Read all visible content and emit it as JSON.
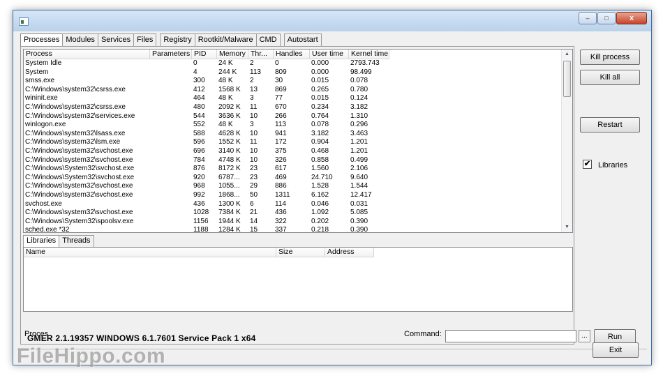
{
  "window": {
    "caption_minimize": "‒",
    "caption_maximize": "□",
    "caption_close": "x"
  },
  "tabs": [
    "Processes",
    "Modules",
    "Services",
    "Files",
    "Registry",
    "Rootkit/Malware",
    "CMD",
    "Autostart"
  ],
  "process_table": {
    "columns": [
      "Process",
      "Parameters",
      "PID",
      "Memory",
      "Thr...",
      "Handles",
      "User time",
      "Kernel time"
    ],
    "rows": [
      [
        "System Idle",
        "",
        "0",
        "24 K",
        "2",
        "0",
        "0.000",
        "2793.743"
      ],
      [
        "System",
        "",
        "4",
        "244 K",
        "113",
        "809",
        "0.000",
        "98.499"
      ],
      [
        "smss.exe",
        "",
        "300",
        "48 K",
        "2",
        "30",
        "0.015",
        "0.078"
      ],
      [
        "C:\\Windows\\system32\\csrss.exe",
        "",
        "412",
        "1568 K",
        "13",
        "869",
        "0.265",
        "0.780"
      ],
      [
        "wininit.exe",
        "",
        "464",
        "48 K",
        "3",
        "77",
        "0.015",
        "0.124"
      ],
      [
        "C:\\Windows\\system32\\csrss.exe",
        "",
        "480",
        "2092 K",
        "11",
        "670",
        "0.234",
        "3.182"
      ],
      [
        "C:\\Windows\\system32\\services.exe",
        "",
        "544",
        "3636 K",
        "10",
        "266",
        "0.764",
        "1.310"
      ],
      [
        "winlogon.exe",
        "",
        "552",
        "48 K",
        "3",
        "113",
        "0.078",
        "0.296"
      ],
      [
        "C:\\Windows\\system32\\lsass.exe",
        "",
        "588",
        "4628 K",
        "10",
        "941",
        "3.182",
        "3.463"
      ],
      [
        "C:\\Windows\\system32\\lsm.exe",
        "",
        "596",
        "1552 K",
        "11",
        "172",
        "0.904",
        "1.201"
      ],
      [
        "C:\\Windows\\system32\\svchost.exe",
        "",
        "696",
        "3140 K",
        "10",
        "375",
        "0.468",
        "1.201"
      ],
      [
        "C:\\Windows\\system32\\svchost.exe",
        "",
        "784",
        "4748 K",
        "10",
        "326",
        "0.858",
        "0.499"
      ],
      [
        "C:\\Windows\\System32\\svchost.exe",
        "",
        "876",
        "8172 K",
        "23",
        "617",
        "1.560",
        "2.106"
      ],
      [
        "C:\\Windows\\System32\\svchost.exe",
        "",
        "920",
        "6787...",
        "23",
        "469",
        "24.710",
        "9.640"
      ],
      [
        "C:\\Windows\\system32\\svchost.exe",
        "",
        "968",
        "1055...",
        "29",
        "886",
        "1.528",
        "1.544"
      ],
      [
        "C:\\Windows\\system32\\svchost.exe",
        "",
        "992",
        "1868...",
        "50",
        "1311",
        "6.162",
        "12.417"
      ],
      [
        "svchost.exe",
        "",
        "436",
        "1300 K",
        "6",
        "114",
        "0.046",
        "0.031"
      ],
      [
        "C:\\Windows\\system32\\svchost.exe",
        "",
        "1028",
        "7384 K",
        "21",
        "436",
        "1.092",
        "5.085"
      ],
      [
        "C:\\Windows\\System32\\spoolsv.exe",
        "",
        "1156",
        "1944 K",
        "14",
        "322",
        "0.202",
        "0.390"
      ],
      [
        "sched.exe *32",
        "",
        "1188",
        "1284 K",
        "15",
        "337",
        "0.218",
        "0.390"
      ]
    ]
  },
  "subtabs": [
    "Libraries",
    "Threads"
  ],
  "libraries_table": {
    "columns": [
      "Name",
      "Size",
      "Address"
    ]
  },
  "status_text": "Proces",
  "command": {
    "label": "Command:",
    "value": "",
    "browse_label": "...",
    "run_label": "Run"
  },
  "buttons": {
    "kill_process": "Kill process",
    "kill_all": "Kill all",
    "restart": "Restart",
    "exit": "Exit"
  },
  "libraries_checkbox": {
    "label": "Libraries",
    "checked": true,
    "mark": "✔"
  },
  "version_text": "GMER 2.1.19357    WINDOWS 6.1.7601 Service Pack 1 x64",
  "watermark": "FileHippo.com"
}
